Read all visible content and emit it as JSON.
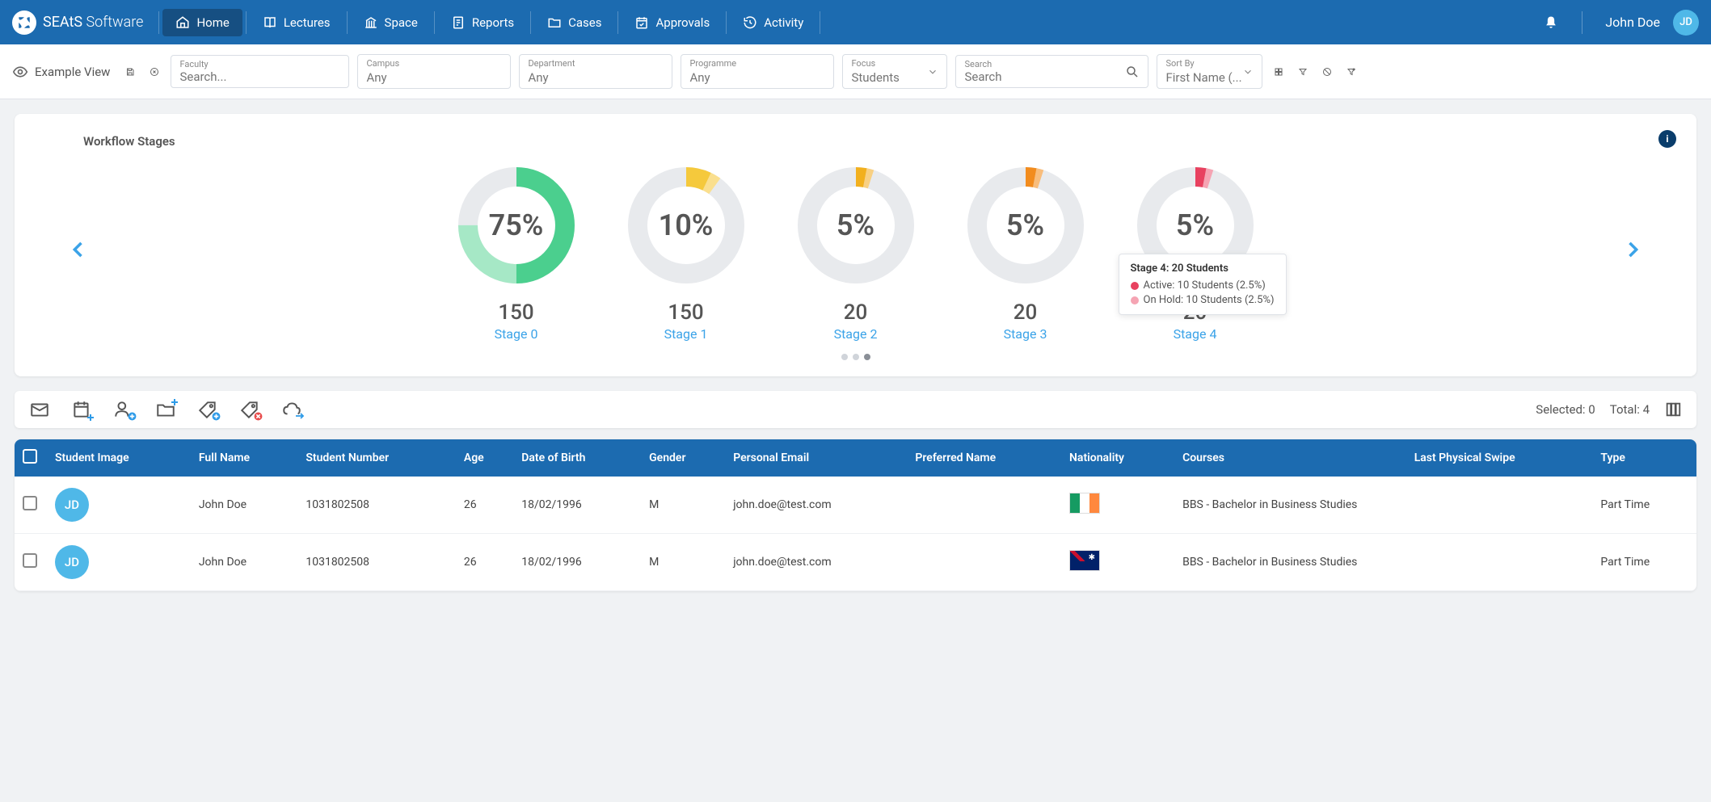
{
  "brand": {
    "name": "SEAtS",
    "suffix": "Software"
  },
  "nav": [
    "Home",
    "Lectures",
    "Space",
    "Reports",
    "Cases",
    "Approvals",
    "Activity"
  ],
  "user": {
    "name": "John Doe",
    "initials": "JD"
  },
  "view": {
    "label": "Example View"
  },
  "filters": {
    "faculty": {
      "label": "Faculty",
      "placeholder": "Search..."
    },
    "campus": {
      "label": "Campus",
      "value": "Any"
    },
    "department": {
      "label": "Department",
      "value": "Any"
    },
    "programme": {
      "label": "Programme",
      "value": "Any"
    },
    "focus": {
      "label": "Focus",
      "value": "Students"
    },
    "search": {
      "label": "Search",
      "placeholder": "Search"
    },
    "sort": {
      "label": "Sort By",
      "value": "First Name (..."
    }
  },
  "workflow": {
    "title": "Workflow Stages",
    "stages": [
      {
        "pct": "75%",
        "count": "150",
        "name": "Stage 0",
        "colorA": "#4bcf8e",
        "colorB": "#a6e8c6",
        "fillA": 50,
        "fillB": 25
      },
      {
        "pct": "10%",
        "count": "150",
        "name": "Stage 1",
        "colorA": "#f5c93c",
        "colorB": "#fadf8e",
        "fillA": 7,
        "fillB": 3
      },
      {
        "pct": "5%",
        "count": "20",
        "name": "Stage 2",
        "colorA": "#f2b01e",
        "colorB": "#f8d083",
        "fillA": 3,
        "fillB": 2
      },
      {
        "pct": "5%",
        "count": "20",
        "name": "Stage 3",
        "colorA": "#f28c1e",
        "colorB": "#f8bd7c",
        "fillA": 3,
        "fillB": 2
      },
      {
        "pct": "5%",
        "count": "20",
        "name": "Stage 4",
        "colorA": "#e8415f",
        "colorB": "#f5a4b3",
        "fillA": 3,
        "fillB": 2
      }
    ],
    "tooltip": {
      "title": "Stage 4: 20 Students",
      "row1": "Active: 10 Students (2.5%)",
      "row2": "On Hold: 10 Students (2.5%)"
    }
  },
  "toolbar": {
    "selected": "Selected: 0",
    "total": "Total: 4"
  },
  "table": {
    "headers": [
      "Student Image",
      "Full Name",
      "Student Number",
      "Age",
      "Date of Birth",
      "Gender",
      "Personal Email",
      "Preferred Name",
      "Nationality",
      "Courses",
      "Last Physical Swipe",
      "Type"
    ],
    "rows": [
      {
        "initials": "JD",
        "name": "John Doe",
        "num": "1031802508",
        "age": "26",
        "dob": "18/02/1996",
        "gender": "M",
        "email": "john.doe@test.com",
        "pref": "",
        "flag": "ie",
        "course": "BBS - Bachelor in Business Studies",
        "swipe": "",
        "type": "Part Time"
      },
      {
        "initials": "JD",
        "name": "John Doe",
        "num": "1031802508",
        "age": "26",
        "dob": "18/02/1996",
        "gender": "M",
        "email": "john.doe@test.com",
        "pref": "",
        "flag": "au",
        "course": "BBS - Bachelor in Business Studies",
        "swipe": "",
        "type": "Part Time"
      }
    ]
  },
  "chart_data": {
    "type": "pie",
    "title": "Workflow Stages",
    "series": [
      {
        "name": "Stage 0",
        "percent": 75,
        "count": 150,
        "segments": [
          {
            "label": "Active",
            "percent": 50
          },
          {
            "label": "On Hold",
            "percent": 25
          }
        ]
      },
      {
        "name": "Stage 1",
        "percent": 10,
        "count": 150,
        "segments": [
          {
            "label": "Active",
            "percent": 7
          },
          {
            "label": "On Hold",
            "percent": 3
          }
        ]
      },
      {
        "name": "Stage 2",
        "percent": 5,
        "count": 20,
        "segments": [
          {
            "label": "Active",
            "percent": 3
          },
          {
            "label": "On Hold",
            "percent": 2
          }
        ]
      },
      {
        "name": "Stage 3",
        "percent": 5,
        "count": 20,
        "segments": [
          {
            "label": "Active",
            "percent": 3
          },
          {
            "label": "On Hold",
            "percent": 2
          }
        ]
      },
      {
        "name": "Stage 4",
        "percent": 5,
        "count": 20,
        "segments": [
          {
            "label": "Active",
            "percent": 2.5,
            "students": 10
          },
          {
            "label": "On Hold",
            "percent": 2.5,
            "students": 10
          }
        ]
      }
    ]
  }
}
